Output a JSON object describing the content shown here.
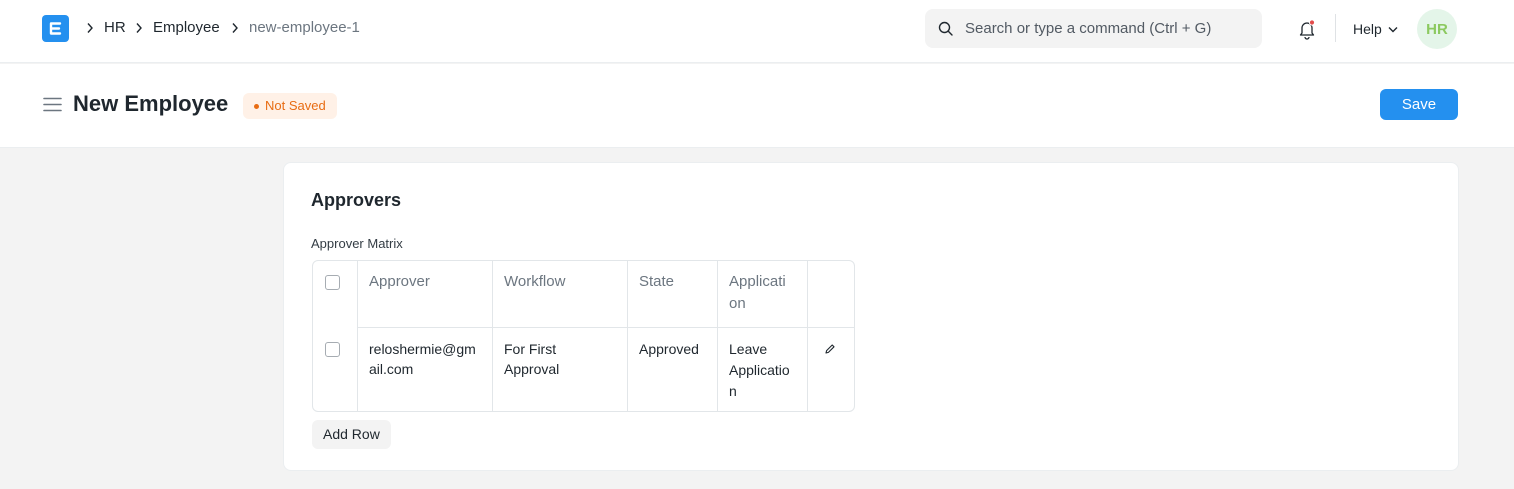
{
  "navbar": {
    "logo_icon": "app-logo-icon",
    "breadcrumbs": [
      "HR",
      "Employee",
      "new-employee-1"
    ],
    "search_placeholder": "Search or type a command (Ctrl + G)",
    "help_label": "Help",
    "avatar_initials": "HR"
  },
  "page": {
    "title": "New Employee",
    "status_badge": "Not Saved",
    "save_label": "Save"
  },
  "section": {
    "title": "Approvers",
    "field_label": "Approver Matrix",
    "columns": [
      "Approver",
      "Workflow",
      "State",
      "Applicati\non"
    ],
    "rows": [
      {
        "approver": "reloshermie@gm\nail.com",
        "workflow": "For First\nApproval",
        "state": "Approved",
        "application": "Leave\nApplicatio\nn"
      }
    ],
    "add_row_label": "Add Row"
  },
  "colors": {
    "primary": "#2490ef",
    "badge_text": "#e86c13",
    "badge_bg": "#fff1e7",
    "avatar_text": "#8cc960",
    "avatar_bg": "#e4f5e9"
  }
}
